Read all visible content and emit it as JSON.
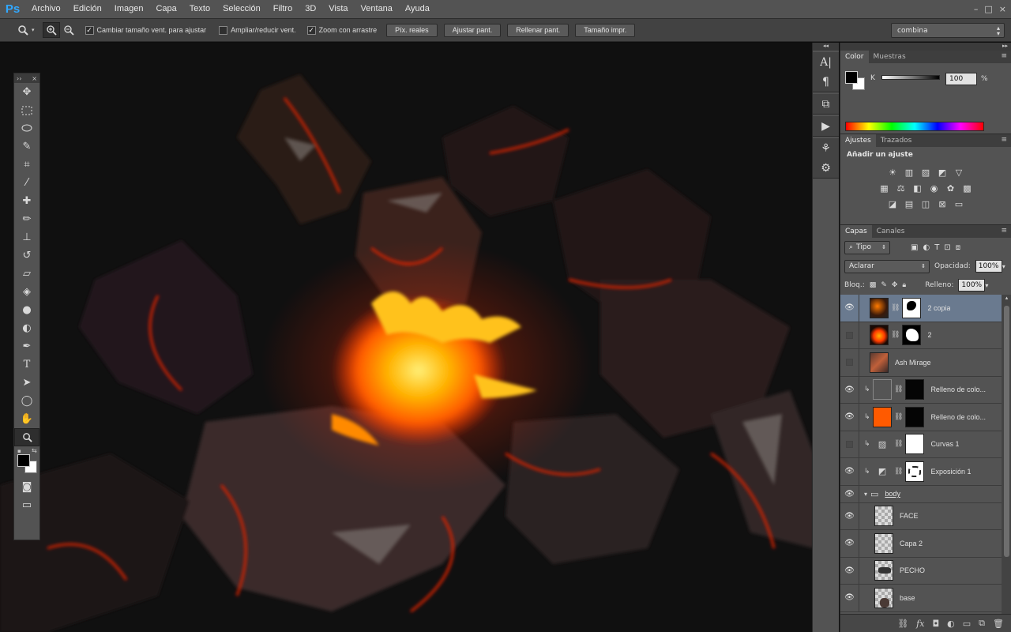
{
  "menubar": {
    "logo": "Ps",
    "items": [
      "Archivo",
      "Edición",
      "Imagen",
      "Capa",
      "Texto",
      "Selección",
      "Filtro",
      "3D",
      "Vista",
      "Ventana",
      "Ayuda"
    ]
  },
  "options": {
    "check_resize": "Cambiar tamaño vent. para ajustar",
    "check_zoom_all": "Ampliar/reducir vent.",
    "check_scrubby": "Zoom con arrastre",
    "btn_actual": "Píx. reales",
    "btn_fit": "Ajustar pant.",
    "btn_fill": "Rellenar pant.",
    "btn_print": "Tamaño impr.",
    "workspace": "combina"
  },
  "color_panel": {
    "tabs": [
      "Color",
      "Muestras"
    ],
    "channel": "K",
    "value": "100",
    "unit": "%"
  },
  "adjust_panel": {
    "tabs": [
      "Ajustes",
      "Trazados"
    ],
    "title": "Añadir un ajuste"
  },
  "layers_panel": {
    "tabs": [
      "Capas",
      "Canales"
    ],
    "filter": "Tipo",
    "blend_mode": "Aclarar",
    "opacity_label": "Opacidad:",
    "opacity": "100%",
    "lock_label": "Bloq.:",
    "fill_label": "Relleno:",
    "fill": "100%",
    "layers": [
      {
        "name": "2 copia",
        "visible": true,
        "selected": true
      },
      {
        "name": "2",
        "visible": false
      },
      {
        "name": "Ash Mirage",
        "visible": false
      },
      {
        "name": "Relleno de colo...",
        "visible": true
      },
      {
        "name": "Relleno de colo...",
        "visible": true
      },
      {
        "name": "Curvas 1",
        "visible": false
      },
      {
        "name": "Exposición 1",
        "visible": true
      },
      {
        "name": "body",
        "visible": true
      },
      {
        "name": "FACE",
        "visible": true
      },
      {
        "name": "Capa 2",
        "visible": true
      },
      {
        "name": "PECHO",
        "visible": true
      },
      {
        "name": "base",
        "visible": true
      }
    ]
  },
  "colors": {
    "accent_orange": "#ff5a00",
    "panel_bg": "#535353",
    "selected_layer": "#6a7a8f"
  }
}
